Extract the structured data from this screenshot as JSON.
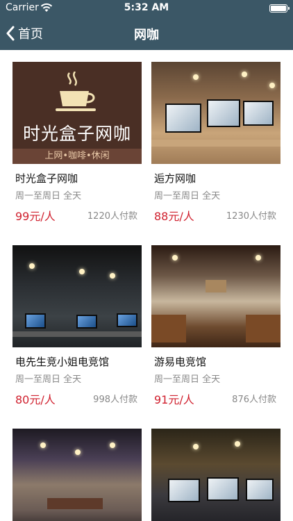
{
  "status_bar": {
    "carrier": "Carrier",
    "time": "5:32 AM"
  },
  "nav": {
    "back_label": "首页",
    "title": "网咖"
  },
  "items": [
    {
      "name": "时光盒子网咖",
      "hours": "周一至周日 全天",
      "price": "99元/人",
      "sales": "1220人付款",
      "logo_text": "时光盒子网咖",
      "logo_sub": "上网•咖啡•休闲"
    },
    {
      "name": "逅方网咖",
      "hours": "周一至周日 全天",
      "price": "88元/人",
      "sales": "1230人付款"
    },
    {
      "name": "电先生竞小姐电竞馆",
      "hours": "周一至周日 全天",
      "price": "80元/人",
      "sales": "998人付款"
    },
    {
      "name": "游易电竞馆",
      "hours": "周一至周日 全天",
      "price": "91元/人",
      "sales": "876人付款"
    },
    {
      "name": "",
      "hours": "",
      "price": "",
      "sales": ""
    },
    {
      "name": "",
      "hours": "",
      "price": "",
      "sales": ""
    }
  ]
}
